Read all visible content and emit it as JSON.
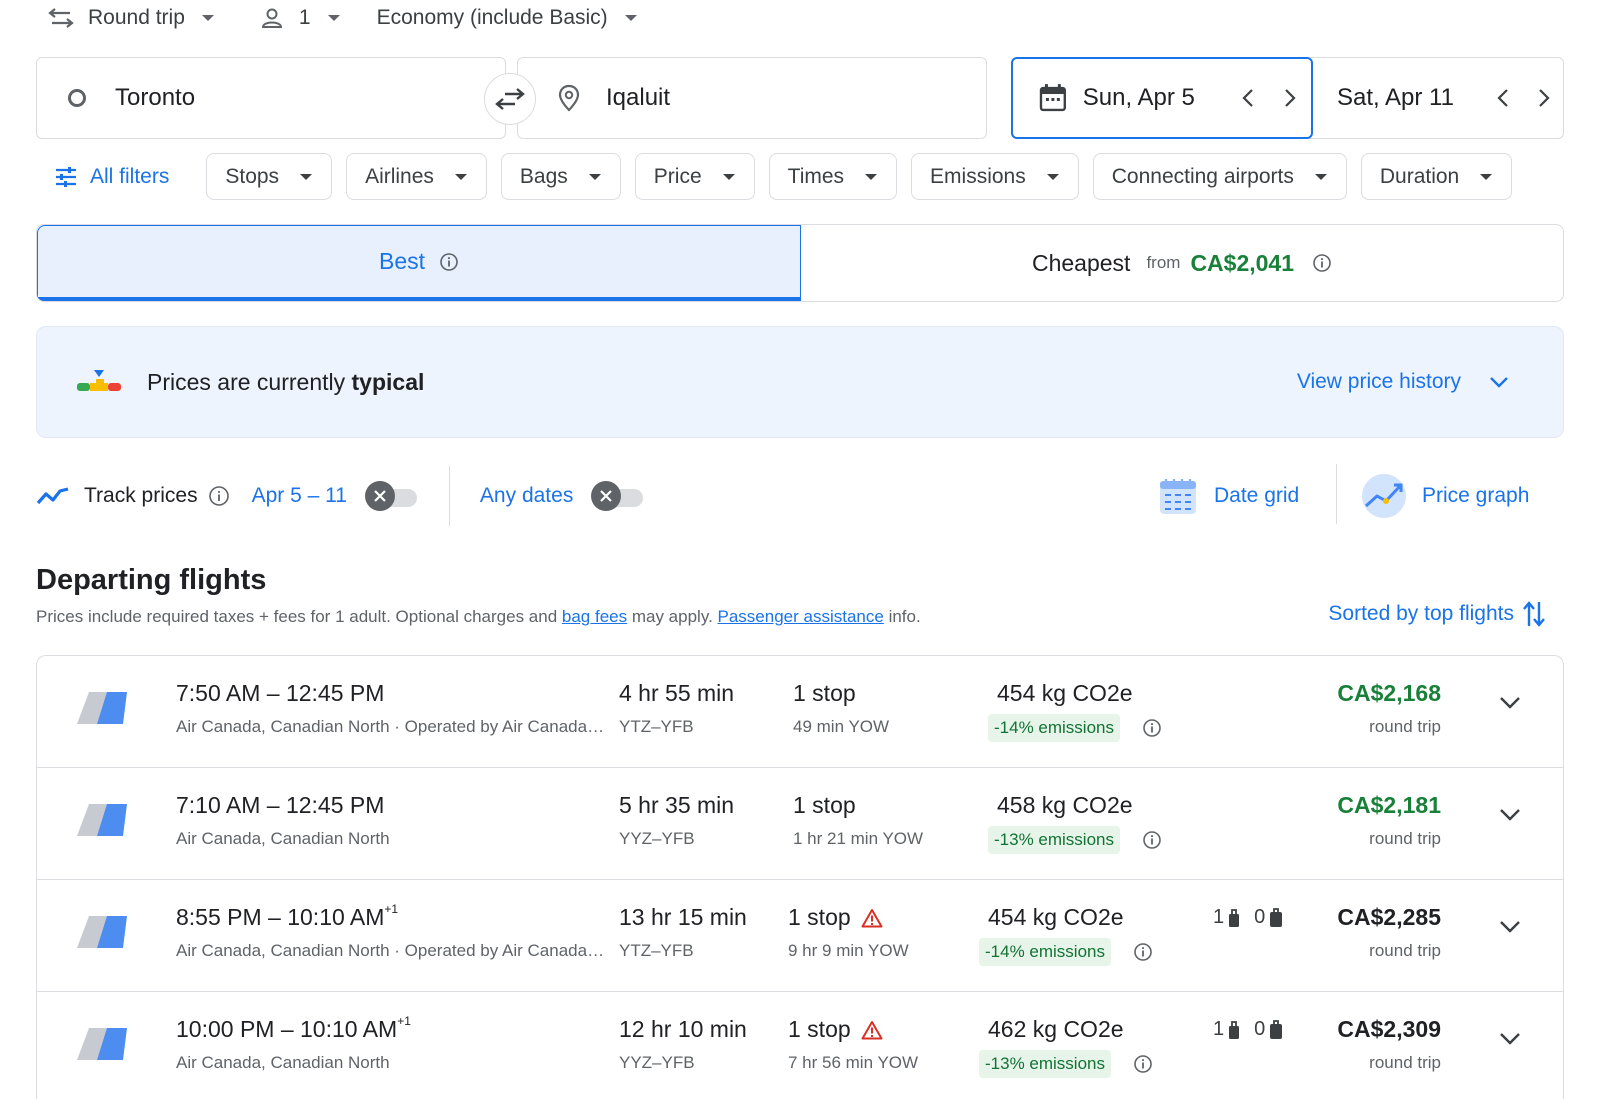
{
  "options": {
    "trip_type": "Round trip",
    "passengers": "1",
    "cabin": "Economy (include Basic)"
  },
  "search": {
    "origin": "Toronto",
    "destination": "Iqaluit",
    "depart_date": "Sun, Apr 5",
    "return_date": "Sat, Apr 11"
  },
  "filters": {
    "all_filters": "All filters",
    "chips": [
      "Stops",
      "Airlines",
      "Bags",
      "Price",
      "Times",
      "Emissions",
      "Connecting airports",
      "Duration"
    ]
  },
  "tabs": {
    "best": "Best",
    "cheapest": "Cheapest",
    "from": "from",
    "cheapest_price": "CA$2,041"
  },
  "insight": {
    "prefix": "Prices are currently ",
    "level": "typical",
    "view_history": "View price history"
  },
  "track": {
    "label": "Track prices",
    "dates": "Apr 5 – 11",
    "any_dates": "Any dates",
    "date_grid": "Date grid",
    "price_graph": "Price graph"
  },
  "section": {
    "title": "Departing flights",
    "note_prefix": "Prices include required taxes + fees for 1 adult. Optional charges and ",
    "bag_fees": "bag fees",
    "note_middle": " may apply. ",
    "passenger_assistance": "Passenger assistance",
    "note_suffix": " info.",
    "sorted": "Sorted by top flights"
  },
  "flights": [
    {
      "times": "7:50 AM – 12:45 PM",
      "plus_day": "",
      "airline": "Air Canada, Canadian North · Operated by Air Canada Express - Jazz",
      "duration": "4 hr 55 min",
      "route": "YTZ–YFB",
      "stops": "1 stop",
      "warning": false,
      "layover": "49 min YOW",
      "co2": "454 kg CO2e",
      "emissions": "-14% emissions",
      "carry_on": "",
      "checked": "",
      "price": "CA$2,168",
      "price_green": true,
      "trip": "round trip"
    },
    {
      "times": "7:10 AM – 12:45 PM",
      "plus_day": "",
      "airline": "Air Canada, Canadian North",
      "duration": "5 hr 35 min",
      "route": "YYZ–YFB",
      "stops": "1 stop",
      "warning": false,
      "layover": "1 hr 21 min YOW",
      "co2": "458 kg CO2e",
      "emissions": "-13% emissions",
      "carry_on": "",
      "checked": "",
      "price": "CA$2,181",
      "price_green": true,
      "trip": "round trip"
    },
    {
      "times": "8:55 PM – 10:10 AM",
      "plus_day": "+1",
      "airline": "Air Canada, Canadian North · Operated by Air Canada Express - Jazz",
      "duration": "13 hr 15 min",
      "route": "YTZ–YFB",
      "stops": "1 stop",
      "warning": true,
      "layover": "9 hr 9 min YOW",
      "co2": "454 kg CO2e",
      "emissions": "-14% emissions",
      "carry_on": "1",
      "checked": "0",
      "price": "CA$2,285",
      "price_green": false,
      "trip": "round trip"
    },
    {
      "times": "10:00 PM – 10:10 AM",
      "plus_day": "+1",
      "airline": "Air Canada, Canadian North",
      "duration": "12 hr 10 min",
      "route": "YYZ–YFB",
      "stops": "1 stop",
      "warning": true,
      "layover": "7 hr 56 min YOW",
      "co2": "462 kg CO2e",
      "emissions": "-13% emissions",
      "carry_on": "1",
      "checked": "0",
      "price": "CA$2,309",
      "price_green": false,
      "trip": "round trip"
    }
  ],
  "colors": {
    "accent": "#1a73e8",
    "green_price": "#188038",
    "emissions_bg": "#e6f4ea",
    "warning": "#d93025",
    "banner_bg": "#eef4fd"
  }
}
